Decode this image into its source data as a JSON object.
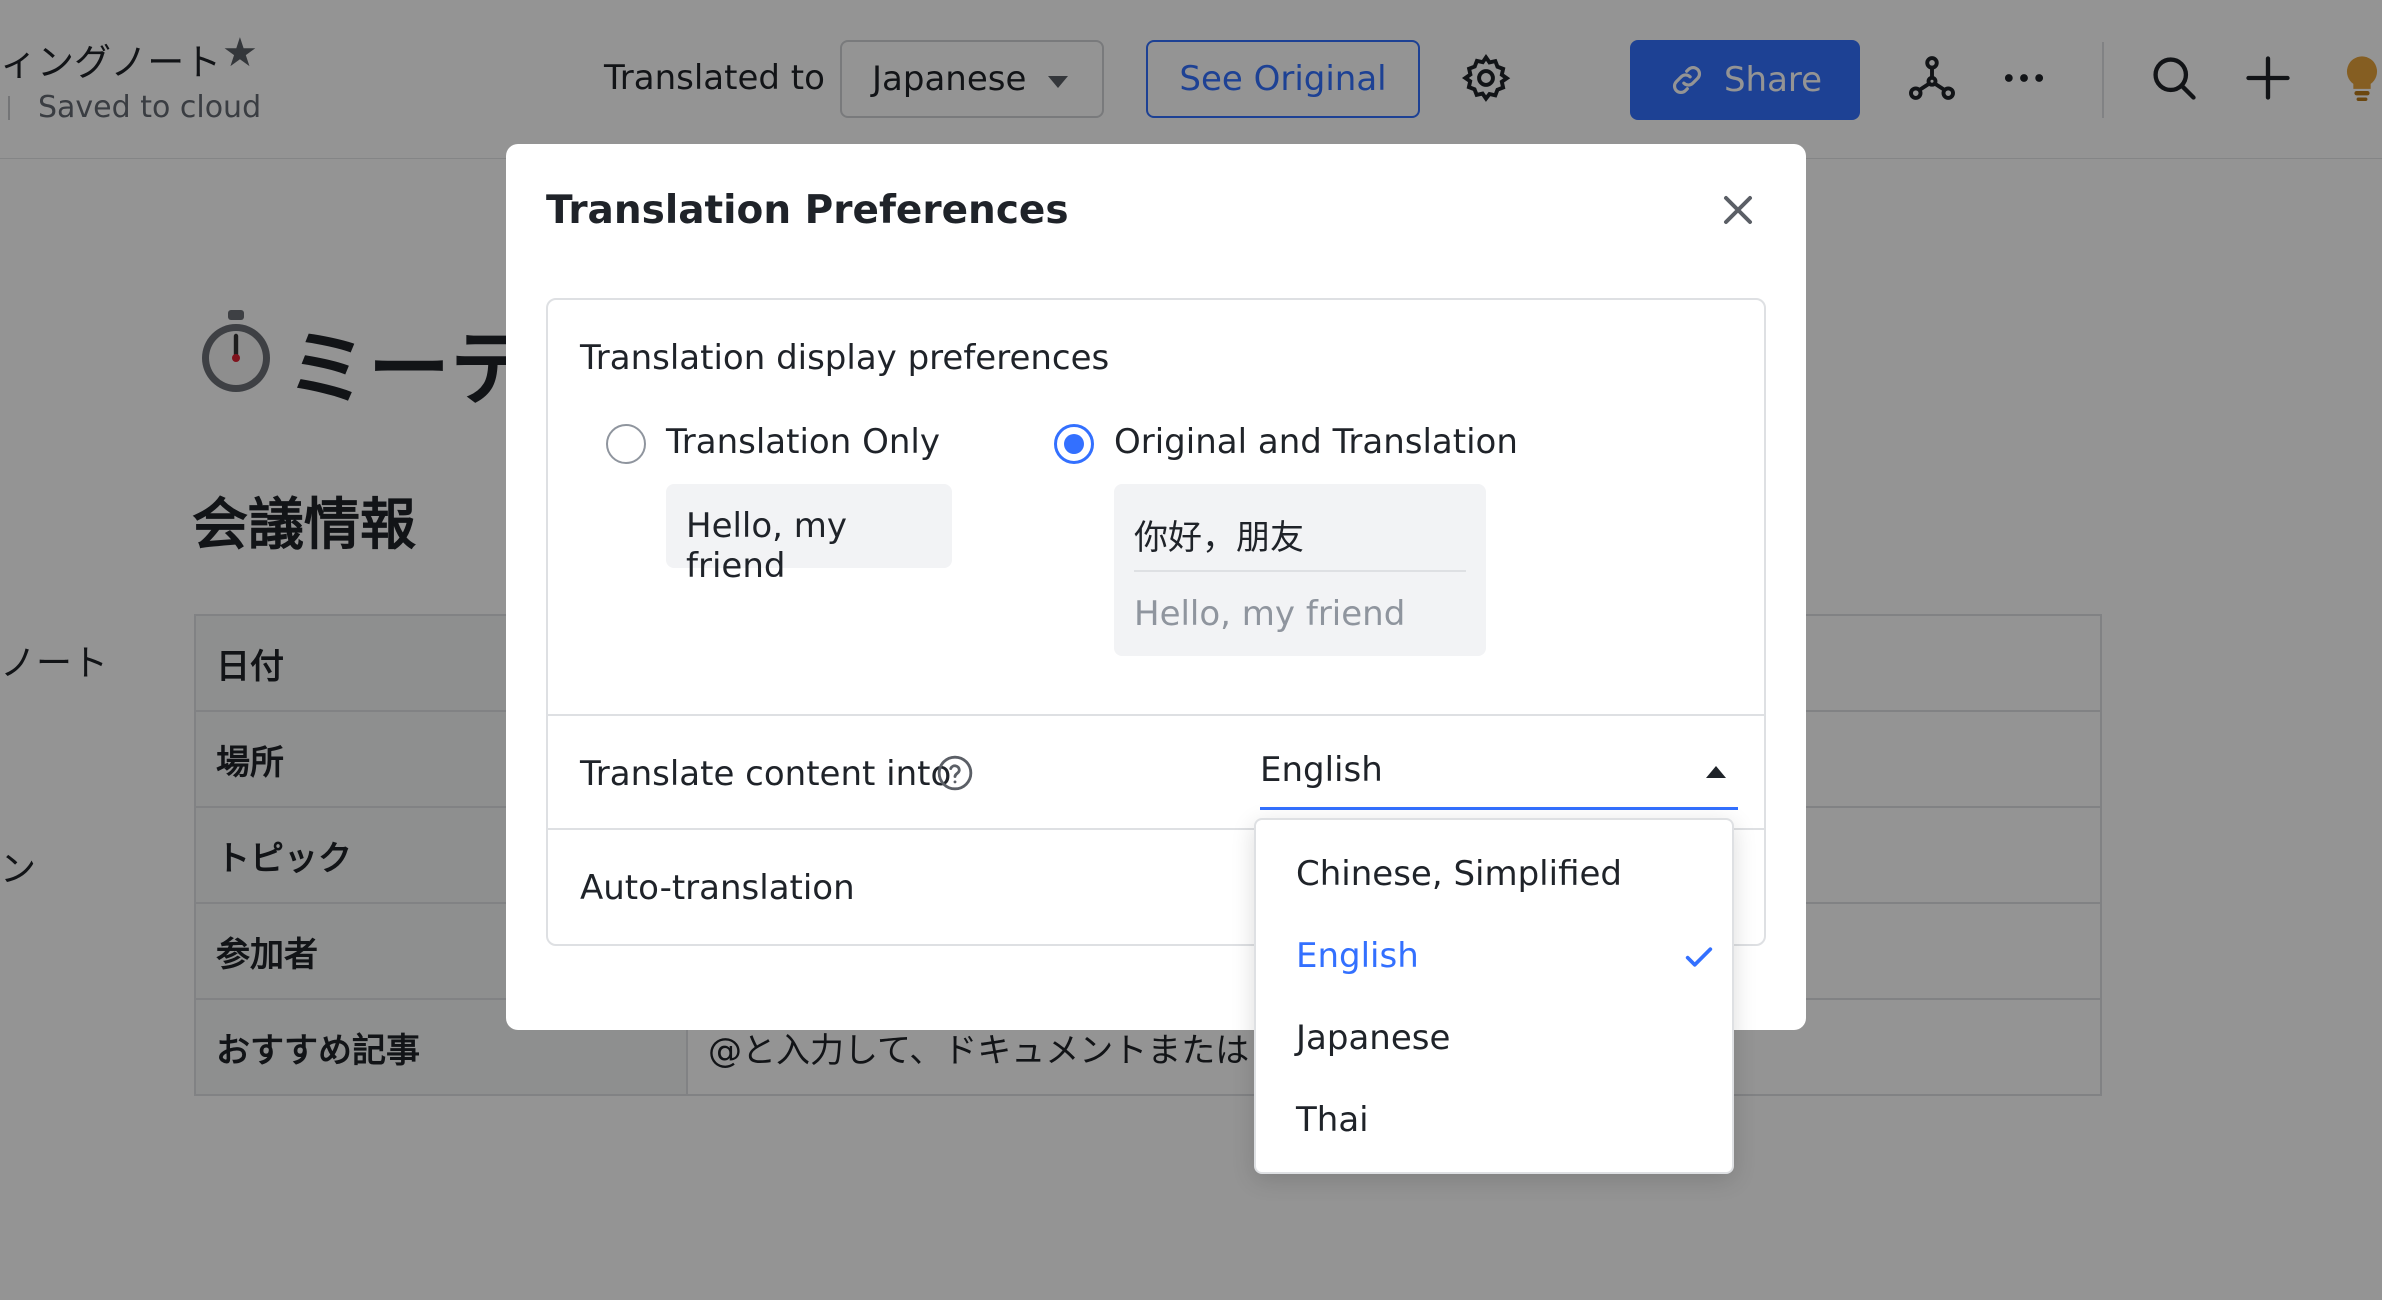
{
  "header": {
    "doc_name": "ィングノート",
    "saved_status": "Saved to cloud",
    "translated_to_label": "Translated to",
    "translated_language": "Japanese",
    "see_original_label": "See Original",
    "share_label": "Share"
  },
  "document": {
    "title": "ミーテ",
    "section_heading": "会議情報",
    "outline": [
      "ノート",
      "ン"
    ],
    "table": [
      {
        "label": "日付",
        "value": ""
      },
      {
        "label": "場所",
        "value": ""
      },
      {
        "label": "トピック",
        "value": ""
      },
      {
        "label": "参加者",
        "value": ""
      },
      {
        "label": "おすすめ記事",
        "value": "@と入力して、ドキュメントまたは"
      }
    ]
  },
  "modal": {
    "title": "Translation Preferences",
    "display_prefs_label": "Translation display preferences",
    "option_translation_only": "Translation Only",
    "option_original_and_translation": "Original and Translation",
    "selected_display_option": "Original and Translation",
    "sample_translation": "Hello, my friend",
    "sample_original": "你好，朋友",
    "translate_into_label": "Translate content into",
    "translate_into_value": "English",
    "auto_translation_label": "Auto-translation"
  },
  "dropdown": {
    "options": [
      "Chinese, Simplified",
      "English",
      "Japanese",
      "Thai"
    ],
    "selected": "English"
  },
  "colors": {
    "accent": "#3370ff",
    "text": "#1f2329",
    "muted": "#8f959e",
    "star": "#5b5f66",
    "lightbulb": "#e6a23c"
  },
  "icons": [
    "star-icon",
    "gear-icon",
    "link-icon",
    "network-icon",
    "more-icon",
    "search-icon",
    "plus-icon",
    "lightbulb-icon",
    "stopwatch-icon",
    "close-icon",
    "help-icon",
    "check-icon"
  ]
}
